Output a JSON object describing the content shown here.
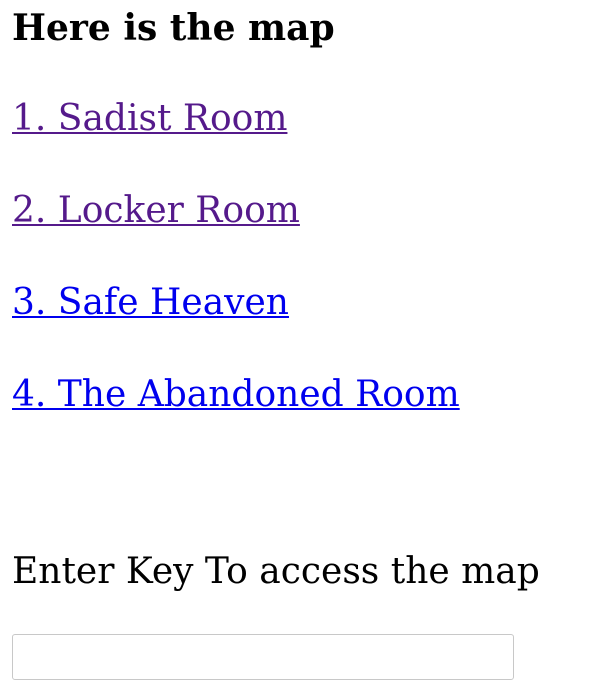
{
  "heading": "Here is the map",
  "links": [
    {
      "label": "1. Sadist Room",
      "visited": true
    },
    {
      "label": "2. Locker Room",
      "visited": true
    },
    {
      "label": "3. Safe Heaven",
      "visited": false
    },
    {
      "label": "4. The Abandoned Room",
      "visited": false
    }
  ],
  "key_form": {
    "label": "Enter Key To access the map",
    "value": "",
    "placeholder": ""
  },
  "colors": {
    "visited_link": "#551a8b",
    "unvisited_link": "#0000ee",
    "text": "#000000",
    "input_border": "#c8c8c8"
  }
}
